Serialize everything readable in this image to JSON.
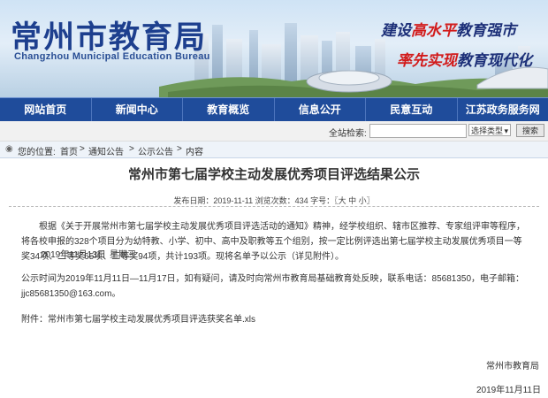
{
  "header": {
    "logo_title": "常州市教育局",
    "logo_subtitle": "Changzhou Municipal Education Bureau",
    "slogan1_a": "建设",
    "slogan1_b": "高水平",
    "slogan1_c": "教育强市",
    "slogan2_a": "率先实现",
    "slogan2_b": "教育现代化"
  },
  "nav": [
    "网站首页",
    "新闻中心",
    "教育概览",
    "信息公开",
    "民意互动",
    "江苏政务服务网"
  ],
  "topbar": {
    "date": "2019年11月13日",
    "weekday": "星期三",
    "search_label": "全站检索:",
    "search_value": "",
    "search_type": "选择类型",
    "search_button": "搜索"
  },
  "breadcrumb": {
    "label": "您的位置:",
    "items": [
      "首页",
      "通知公告",
      "公示公告",
      "内容"
    ],
    "separator": ">"
  },
  "article": {
    "title": "常州市第七届学校主动发展优秀项目评选结果公示",
    "meta": "发布日期：2019-11-11  浏览次数：434  字号：〖大 中 小〗",
    "p1": "根据《关于开展常州市第七届学校主动发展优秀项目评选活动的通知》精神，经学校组织、辖市区推荐、专家组评审等程序，将各校申报的328个项目分为幼特教、小学、初中、高中及职教等五个组别，按一定比例评选出第七届学校主动发展优秀项目一等奖34项、二等奖65项、三等奖94项，共计193项。现将名单予以公示（详见附件）。",
    "p2": "公示时间为2019年11月11日—11月17日，如有疑问，请及时向常州市教育局基础教育处反映，联系电话：85681350，电子邮箱：jjc85681350@163.com。",
    "attachment_label": "附件：",
    "attachment_name": "常州市第七届学校主动发展优秀项目评选获奖名单.xls",
    "signature": "常州市教育局",
    "sign_date": "2019年11月11日"
  },
  "colors": {
    "nav_bg": "#1f4c9b",
    "logo": "#1d3f8e",
    "highlight": "#d21a1a"
  }
}
